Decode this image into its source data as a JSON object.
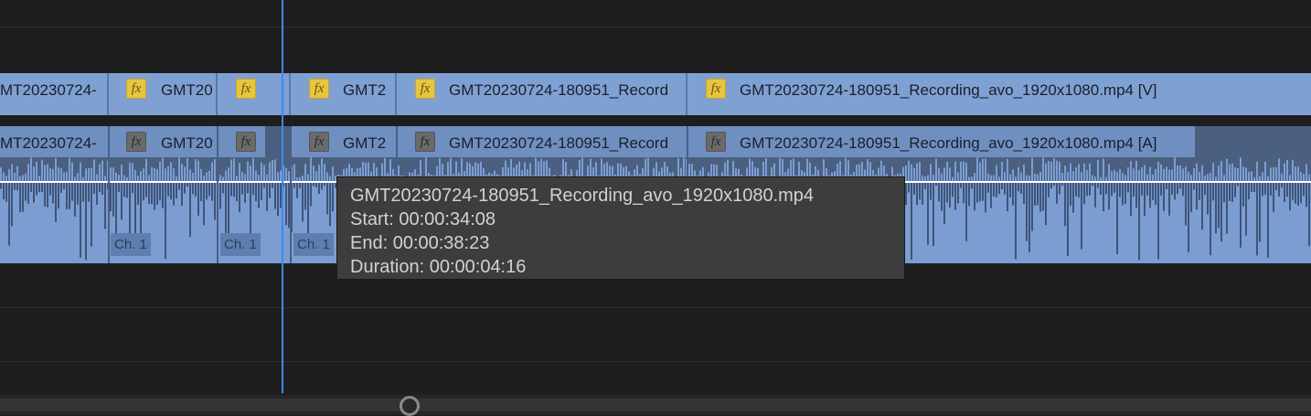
{
  "timeline": {
    "video_clips": [
      {
        "name": "MT20230724-",
        "fx": false
      },
      {
        "name": "GMT20",
        "fx": true
      },
      {
        "name": "",
        "fx": true
      },
      {
        "name": "GMT2",
        "fx": true
      },
      {
        "name": "GMT20230724-180951_Record",
        "fx": true
      },
      {
        "name": "GMT20230724-180951_Recording_avo_1920x1080.mp4 [V]",
        "fx": true
      }
    ],
    "audio_clips": [
      {
        "name": "MT20230724-"
      },
      {
        "name": "GMT20"
      },
      {
        "name": ""
      },
      {
        "name": "GMT2"
      },
      {
        "name": "GMT20230724-180951_Record"
      },
      {
        "name": "GMT20230724-180951_Recording_avo_1920x1080.mp4 [A]"
      }
    ],
    "channel_badges": [
      "Ch. 1",
      "Ch. 1",
      "Ch. 1"
    ],
    "fx_label": "fx"
  },
  "tooltip": {
    "filename": "GMT20230724-180951_Recording_avo_1920x1080.mp4",
    "start": "Start: 00:00:34:08",
    "end": "End: 00:00:38:23",
    "duration": "Duration: 00:00:04:16"
  },
  "colors": {
    "playhead": "#3f88f0",
    "video_clip": "#7fa0d3",
    "audio_clip": "#7b9dd2",
    "fx_active": "#e7c53d"
  }
}
